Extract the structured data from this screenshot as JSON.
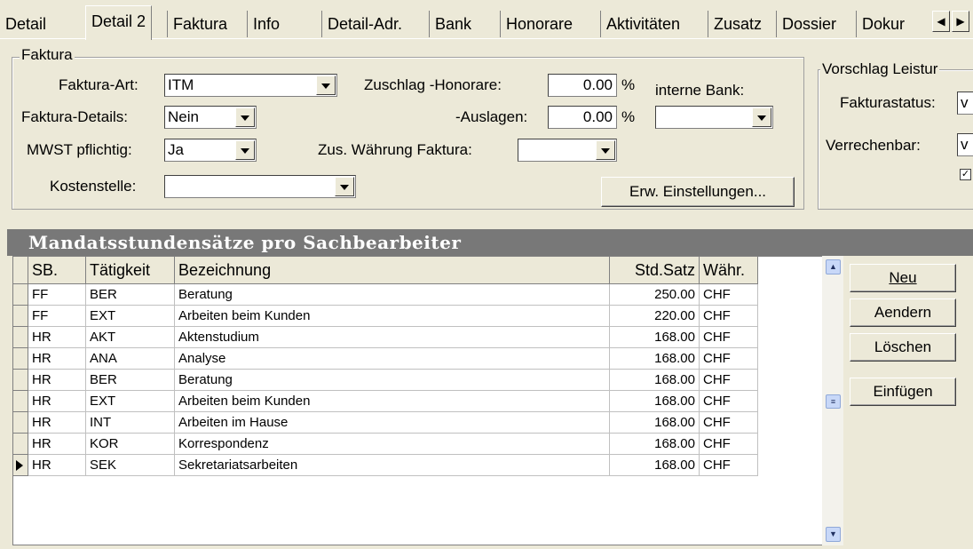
{
  "tabs": [
    "Detail",
    "Detail 2",
    "Faktura",
    "Info",
    "Detail-Adr.",
    "Bank",
    "Honorare",
    "Aktivitäten",
    "Zusatz",
    "Dossier",
    "Dokur"
  ],
  "active_tab": "Detail 2",
  "faktura": {
    "legend": "Faktura",
    "faktura_art_label": "Faktura-Art:",
    "faktura_art_value": "ITM",
    "faktura_details_label": "Faktura-Details:",
    "faktura_details_value": "Nein",
    "mwst_label": "MWST pflichtig:",
    "mwst_value": "Ja",
    "kostenstelle_label": "Kostenstelle:",
    "kostenstelle_value": "",
    "zuschlag_honorare_label": "Zuschlag  -Honorare:",
    "zuschlag_honorare_value": "0.00",
    "auslagen_label": "-Auslagen:",
    "auslagen_value": "0.00",
    "percent": "%",
    "interne_bank_label": "interne Bank:",
    "interne_bank_value": "",
    "zus_waehrung_label": "Zus. Währung Faktura:",
    "zus_waehrung_value": "",
    "erw_button": "Erw. Einstellungen..."
  },
  "vorschlag": {
    "legend": "Vorschlag Leistur",
    "fakturastatus_label": "Fakturastatus:",
    "fakturastatus_value": "v",
    "verrechenbar_label": "Verrechenbar:",
    "verrechenbar_value": "v"
  },
  "section_title": "Mandatsstundensätze pro Sachbearbeiter",
  "table": {
    "columns": [
      "SB.",
      "Tätigkeit",
      "Bezeichnung",
      "Std.Satz",
      "Währ."
    ],
    "rows": [
      [
        "FF",
        "BER",
        "Beratung",
        "250.00",
        "CHF"
      ],
      [
        "FF",
        "EXT",
        "Arbeiten beim Kunden",
        "220.00",
        "CHF"
      ],
      [
        "HR",
        "AKT",
        "Aktenstudium",
        "168.00",
        "CHF"
      ],
      [
        "HR",
        "ANA",
        "Analyse",
        "168.00",
        "CHF"
      ],
      [
        "HR",
        "BER",
        "Beratung",
        "168.00",
        "CHF"
      ],
      [
        "HR",
        "EXT",
        "Arbeiten beim Kunden",
        "168.00",
        "CHF"
      ],
      [
        "HR",
        "INT",
        "Arbeiten im Hause",
        "168.00",
        "CHF"
      ],
      [
        "HR",
        "KOR",
        "Korrespondenz",
        "168.00",
        "CHF"
      ],
      [
        "HR",
        "SEK",
        "Sekretariatsarbeiten",
        "168.00",
        "CHF"
      ]
    ],
    "current_row_index": 8
  },
  "buttons": {
    "neu": "Neu",
    "aendern": "Aendern",
    "loeschen": "Löschen",
    "einfuegen": "Einfügen"
  },
  "icons": {
    "tab_prev": "arrow-left-icon",
    "tab_next": "arrow-right-icon",
    "dropdown": "chevron-down-icon",
    "scroll_up": "scroll-up-icon",
    "scroll_down": "scroll-down-icon",
    "current_row": "row-pointer-icon"
  }
}
